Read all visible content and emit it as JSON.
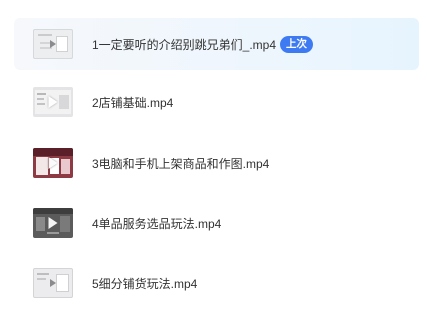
{
  "playlist": {
    "items": [
      {
        "title": "1一定要听的介绍别跳兄弟们_.mp4",
        "badge": "上次",
        "thumb_icon": "video-thumbnail-icon"
      },
      {
        "title": "2店铺基础.mp4",
        "thumb_icon": "video-thumbnail-icon"
      },
      {
        "title": "3电脑和手机上架商品和作图.mp4",
        "thumb_icon": "video-thumbnail-icon"
      },
      {
        "title": "4单品服务选品玩法.mp4",
        "thumb_icon": "video-thumbnail-icon"
      },
      {
        "title": "5细分铺货玩法.mp4",
        "thumb_icon": "video-thumbnail-icon"
      }
    ]
  },
  "colors": {
    "badge": "#3e7bf2",
    "active_row": "#eef6fd",
    "text": "#333333"
  }
}
